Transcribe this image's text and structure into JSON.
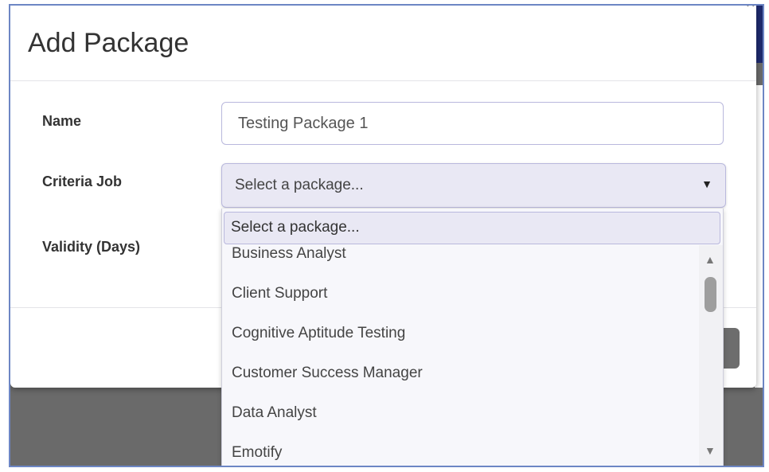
{
  "modal": {
    "title": "Add Package",
    "close_glyph": "×"
  },
  "form": {
    "name_label": "Name",
    "name_value": "Testing Package 1",
    "criteria_label": "Criteria Job",
    "criteria_selected": "Select a package...",
    "validity_label": "Validity (Days)"
  },
  "dropdown": {
    "search_text": "Select a package...",
    "options": [
      "Business Analyst",
      "Client Support",
      "Cognitive Aptitude Testing",
      "Customer Success Manager",
      "Data Analyst",
      "Emotify"
    ]
  },
  "icons": {
    "caret": "caret-down-icon",
    "scroll_up": "scroll-up-icon",
    "scroll_down": "scroll-down-icon"
  },
  "colors": {
    "select_bg": "#e9e8f4",
    "border": "#b9b8dd",
    "backdrop": "#6a6a6a",
    "footer_button": "#6d6d6d"
  }
}
